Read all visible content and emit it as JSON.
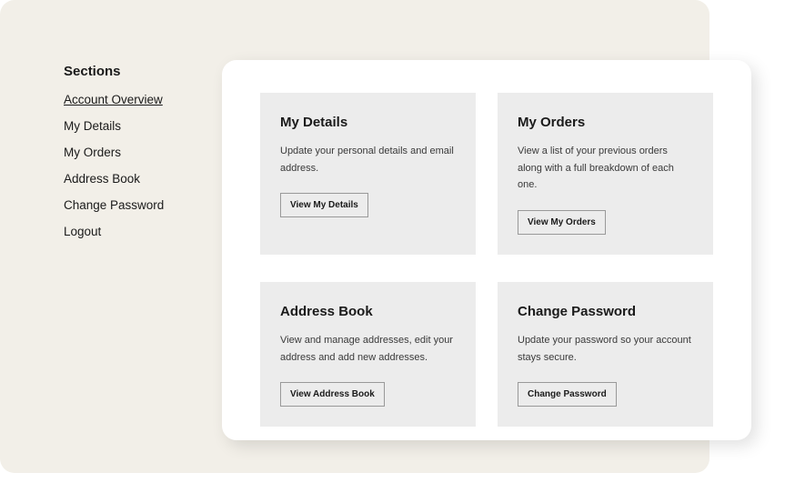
{
  "sidebar": {
    "title": "Sections",
    "items": [
      {
        "label": "Account Overview",
        "active": true
      },
      {
        "label": "My Details",
        "active": false
      },
      {
        "label": "My Orders",
        "active": false
      },
      {
        "label": "Address Book",
        "active": false
      },
      {
        "label": "Change Password",
        "active": false
      },
      {
        "label": "Logout",
        "active": false
      }
    ]
  },
  "cards": [
    {
      "title": "My Details",
      "description": "Update your personal details and email address.",
      "button": "View My Details"
    },
    {
      "title": "My Orders",
      "description": "View a list of your previous orders along with a full breakdown of each one.",
      "button": "View My Orders"
    },
    {
      "title": "Address Book",
      "description": "View and manage addresses, edit your address and add new addresses.",
      "button": "View Address Book"
    },
    {
      "title": "Change Password",
      "description": "Update your password so your account stays secure.",
      "button": "Change Password"
    }
  ]
}
